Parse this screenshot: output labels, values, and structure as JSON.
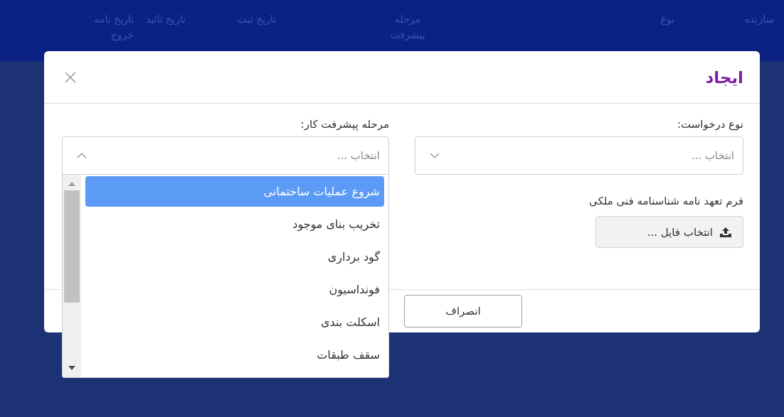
{
  "table": {
    "columns": [
      "سازنده",
      "نوع",
      "مرحله پیشرفت",
      "تاریخ ثبت",
      "تاریخ تائید",
      "تاریخ نامه خروج"
    ]
  },
  "dialog": {
    "title": "ایجاد",
    "fields": [
      {
        "kind": "select",
        "label": "نوع درخواست:",
        "placeholder": "انتخاب ...",
        "expanded": false
      },
      {
        "kind": "select",
        "label": "مرحله پیشرفت کار:",
        "placeholder": "انتخاب ...",
        "expanded": true,
        "options": [
          {
            "label": "شروع عملیات ساختمانی",
            "selected": true
          },
          {
            "label": "تخریب بنای موجود",
            "selected": false
          },
          {
            "label": "گود برداری",
            "selected": false
          },
          {
            "label": "فونداسیون",
            "selected": false
          },
          {
            "label": "اسکلت بندی",
            "selected": false
          },
          {
            "label": "سقف طبقات",
            "selected": false
          }
        ]
      },
      {
        "kind": "file",
        "label": "فرم تعهد نامه شناسنامه فنی ملکی",
        "button": "انتخاب فایل ..."
      }
    ],
    "buttons": [
      "انصراف"
    ]
  }
}
